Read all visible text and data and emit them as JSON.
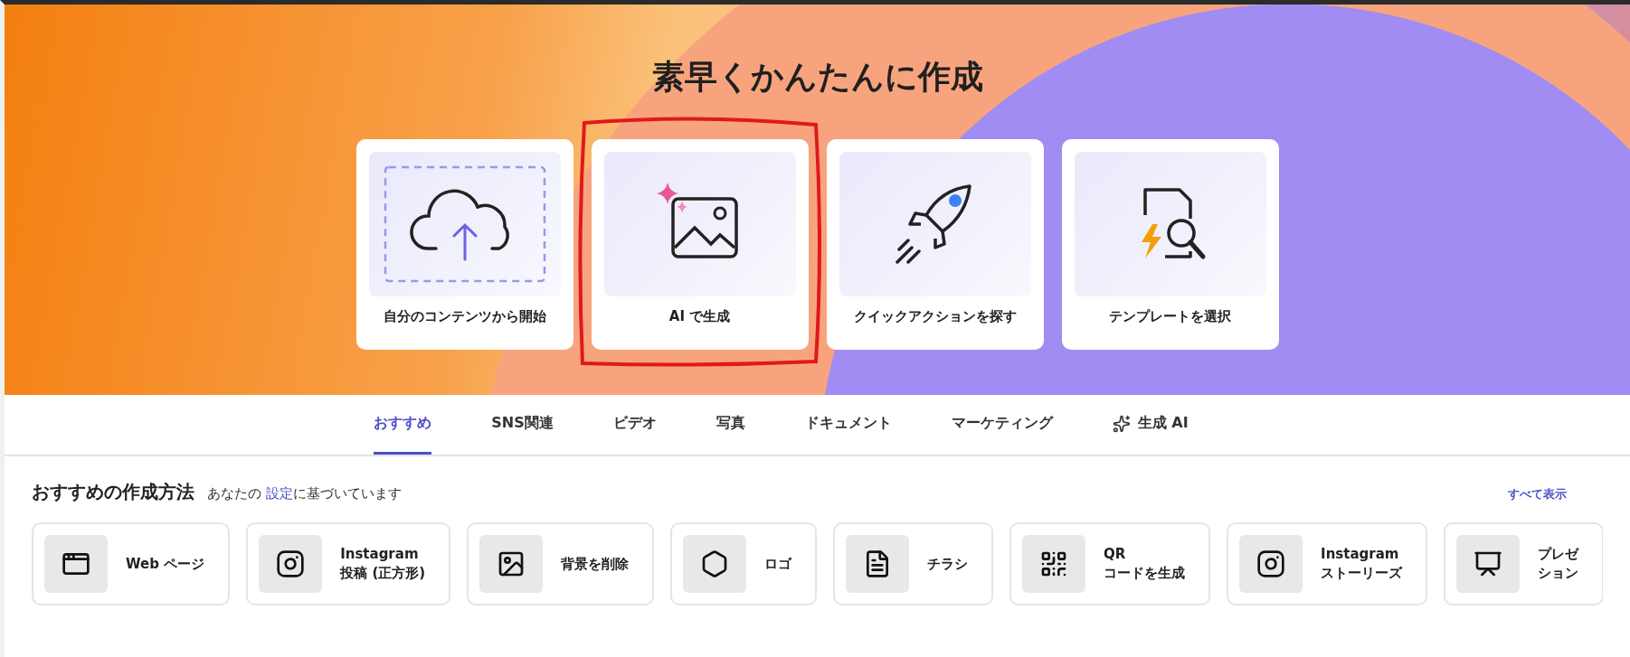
{
  "hero": {
    "title": "素早くかんたんに作成",
    "cards": [
      {
        "label": "自分のコンテンツから開始"
      },
      {
        "label": "AI で生成",
        "circled": true
      },
      {
        "label": "クイックアクションを探す"
      },
      {
        "label": "テンプレートを選択"
      }
    ]
  },
  "tabs": [
    {
      "label": "おすすめ",
      "selected": true
    },
    {
      "label": "SNS関連",
      "selected": false
    },
    {
      "label": "ビデオ",
      "selected": false
    },
    {
      "label": "写真",
      "selected": false
    },
    {
      "label": "ドキュメント",
      "selected": false
    },
    {
      "label": "マーケティング",
      "selected": false
    },
    {
      "label": "生成 AI",
      "selected": false
    }
  ],
  "section": {
    "title": "おすすめの作成方法",
    "subtitle_before": "あなたの",
    "subtitle_link": "設定",
    "subtitle_after": "に基づいています",
    "see_all": "すべて表示",
    "items": [
      {
        "lines": [
          "Web ページ"
        ]
      },
      {
        "lines": [
          "Instagram",
          "投稿 (正方形)"
        ]
      },
      {
        "lines": [
          "背景を削除"
        ]
      },
      {
        "lines": [
          "ロゴ"
        ]
      },
      {
        "lines": [
          "チラシ"
        ]
      },
      {
        "lines": [
          "QR",
          "コードを生成"
        ]
      },
      {
        "lines": [
          "Instagram",
          "ストーリーズ"
        ]
      },
      {
        "lines": [
          "プレゼ",
          "ション"
        ]
      }
    ]
  }
}
